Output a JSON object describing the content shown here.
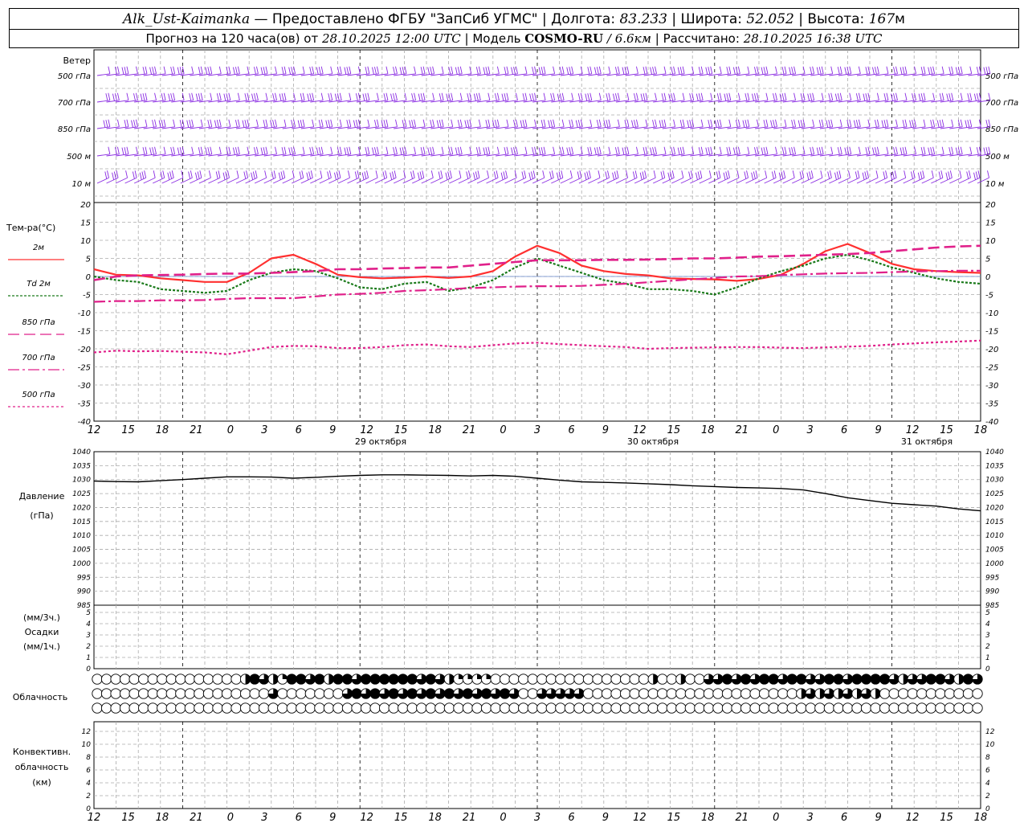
{
  "header": {
    "station": "Alk_Ust-Kaimanka",
    "provider": "— Предоставлено ФГБУ \"ЗапСиб УГМС\"",
    "lon_label": "| Долгота:",
    "lon_value": "83.233",
    "lat_label": "| Широта:",
    "lat_value": "52.052",
    "alt_label": "| Высота:",
    "alt_value": "167",
    "alt_unit": "м",
    "forecast_label": "Прогноз на 120 часа(ов) от",
    "forecast_start": "28.10.2025 12:00 UTC",
    "model_label": "| Модель",
    "model_name": "COSMO-RU",
    "model_res": "/ 6.6км",
    "computed_label": "| Рассчитано:",
    "computed_value": "28.10.2025 16:38 UTC"
  },
  "colors": {
    "wind": "#8a2be2",
    "t2m": "#ff3030",
    "td2m": "#1a7a1a",
    "t850": "#e0208a",
    "t700": "#e0208a",
    "t500": "#e0208a",
    "pressure": "#000000",
    "grid": "#aaaaaa"
  },
  "chart_data": [
    {
      "type": "line",
      "panel": "wind",
      "ylabel": "Ветер",
      "levels": [
        "500 гПа",
        "700 гПа",
        "850 гПа",
        "500 м",
        "10 м"
      ],
      "icon": "wind-barb-icon"
    },
    {
      "type": "line",
      "panel": "temperature",
      "ylabel": "Тем-ра(°C)",
      "ylim": [
        -40,
        20
      ],
      "y_ticks": [
        20,
        15,
        10,
        5,
        0,
        -5,
        -10,
        -15,
        -20,
        -25,
        -30,
        -35,
        -40
      ],
      "x": [
        0,
        3,
        6,
        9,
        12,
        15,
        18,
        21,
        24,
        27,
        30,
        33,
        36,
        39,
        42,
        45,
        48,
        51,
        54,
        57,
        60,
        63,
        66,
        69,
        72,
        75,
        78,
        81,
        84,
        87,
        90,
        93,
        96,
        99,
        102,
        105,
        108,
        111,
        114,
        117,
        120
      ],
      "x_tick_labels": [
        "12",
        "15",
        "18",
        "21",
        "0",
        "3",
        "6",
        "9",
        "12",
        "15",
        "18",
        "21",
        "0",
        "3",
        "6",
        "9",
        "12",
        "15",
        "18",
        "21",
        "0",
        "3",
        "6",
        "9",
        "12",
        "15",
        "18"
      ],
      "date_labels": [
        "29 октября",
        "30 октября",
        "31 октября"
      ],
      "series": [
        {
          "name": "2м",
          "values": [
            2,
            0.5,
            0.3,
            -0.5,
            -1,
            -1.5,
            -1.5,
            1,
            5,
            6,
            3.5,
            0.5,
            -0.2,
            -0.5,
            -0.3,
            0,
            -0.4,
            0,
            1.5,
            5.5,
            8.5,
            6.5,
            3,
            1.5,
            0.7,
            0.3,
            -0.5,
            -0.7,
            -0.8,
            -1.2,
            -0.7,
            0.5,
            3.5,
            7,
            9,
            6.5,
            3.5,
            2,
            1.5,
            1.2,
            1
          ]
        },
        {
          "name": "Td 2м",
          "values": [
            0,
            -1,
            -1.5,
            -3.5,
            -4,
            -4.5,
            -4,
            -1,
            1,
            2,
            1.5,
            -0.5,
            -3,
            -3.5,
            -2,
            -1.5,
            -4,
            -3,
            -1,
            2.5,
            5,
            3,
            1,
            -1,
            -2,
            -3.5,
            -3.5,
            -4,
            -5,
            -3,
            -0.5,
            1.5,
            3,
            5,
            6,
            4.5,
            2.5,
            1,
            -0.5,
            -1.5,
            -2
          ]
        },
        {
          "name": "850 гПа",
          "values": [
            -1,
            0,
            0.3,
            0.4,
            0.5,
            0.7,
            0.8,
            0.8,
            1,
            1.2,
            1.5,
            2,
            2,
            2.2,
            2.3,
            2.5,
            2.5,
            3,
            3.5,
            4,
            4.5,
            4.5,
            4.5,
            4.6,
            4.6,
            4.7,
            4.8,
            5,
            5,
            5.2,
            5.5,
            5.6,
            5.8,
            6,
            6.2,
            6.5,
            7,
            7.5,
            8,
            8.3,
            8.5
          ]
        },
        {
          "name": "700 гПа",
          "values": [
            -7,
            -6.8,
            -6.8,
            -6.6,
            -6.6,
            -6.5,
            -6.2,
            -6,
            -6,
            -6,
            -5.5,
            -5,
            -4.8,
            -4.5,
            -4,
            -3.8,
            -3.5,
            -3.2,
            -3,
            -2.8,
            -2.7,
            -2.7,
            -2.6,
            -2.3,
            -2,
            -1.6,
            -1.2,
            -0.8,
            -0.4,
            0,
            0.1,
            0.4,
            0.6,
            0.8,
            0.9,
            1,
            1.2,
            1.4,
            1.5,
            1.6,
            1.6
          ]
        },
        {
          "name": "500 гПа",
          "values": [
            -21,
            -20.5,
            -20.7,
            -20.6,
            -20.8,
            -21,
            -21.5,
            -20.5,
            -19.5,
            -19.2,
            -19.3,
            -19.8,
            -19.8,
            -19.5,
            -19,
            -18.8,
            -19.3,
            -19.5,
            -19,
            -18.5,
            -18.3,
            -18.7,
            -19,
            -19.3,
            -19.5,
            -20,
            -19.8,
            -19.7,
            -19.6,
            -19.5,
            -19.5,
            -19.7,
            -19.8,
            -19.6,
            -19.4,
            -19.2,
            -18.8,
            -18.5,
            -18.2,
            -18,
            -17.7
          ]
        }
      ]
    },
    {
      "type": "line",
      "panel": "pressure",
      "ylabel": "Давление",
      "yunit": "(гПа)",
      "ylim": [
        985,
        1040
      ],
      "y_ticks": [
        1040,
        1035,
        1030,
        1025,
        1020,
        1015,
        1010,
        1005,
        1000,
        995,
        990,
        985
      ],
      "series": [
        {
          "name": "Давление",
          "values": [
            1029.5,
            1029.3,
            1029.2,
            1029.6,
            1030,
            1030.5,
            1031,
            1031,
            1030.9,
            1030.5,
            1030.8,
            1031.2,
            1031.5,
            1031.7,
            1031.7,
            1031.6,
            1031.5,
            1031.3,
            1031.5,
            1031.2,
            1030.5,
            1029.8,
            1029.2,
            1029,
            1028.8,
            1028.5,
            1028.2,
            1027.8,
            1027.5,
            1027.2,
            1027,
            1026.8,
            1026.3,
            1025,
            1023.5,
            1022.5,
            1021.5,
            1021,
            1020.5,
            1019.5,
            1018.8
          ]
        }
      ]
    },
    {
      "type": "bar",
      "panel": "precipitation",
      "ylabel": "Осадки",
      "yunit_3h": "(мм/3ч.)",
      "yunit_1h": "(мм/1ч.)",
      "ylim": [
        0,
        5
      ],
      "y_ticks": [
        5,
        4,
        3,
        2,
        1,
        0
      ],
      "values": []
    },
    {
      "type": "table",
      "panel": "cloudiness",
      "ylabel": "Облачность",
      "row_count": 3,
      "cell_count": 96,
      "states": [
        "empty",
        "quarter",
        "half",
        "three-quarter",
        "full"
      ]
    },
    {
      "type": "bar",
      "panel": "convective",
      "ylabel_lines": [
        "Конвективн.",
        "облачность",
        "(км)"
      ],
      "ylim": [
        0,
        13
      ],
      "y_ticks": [
        12,
        10,
        8,
        6,
        4,
        2,
        0
      ],
      "values": []
    }
  ]
}
